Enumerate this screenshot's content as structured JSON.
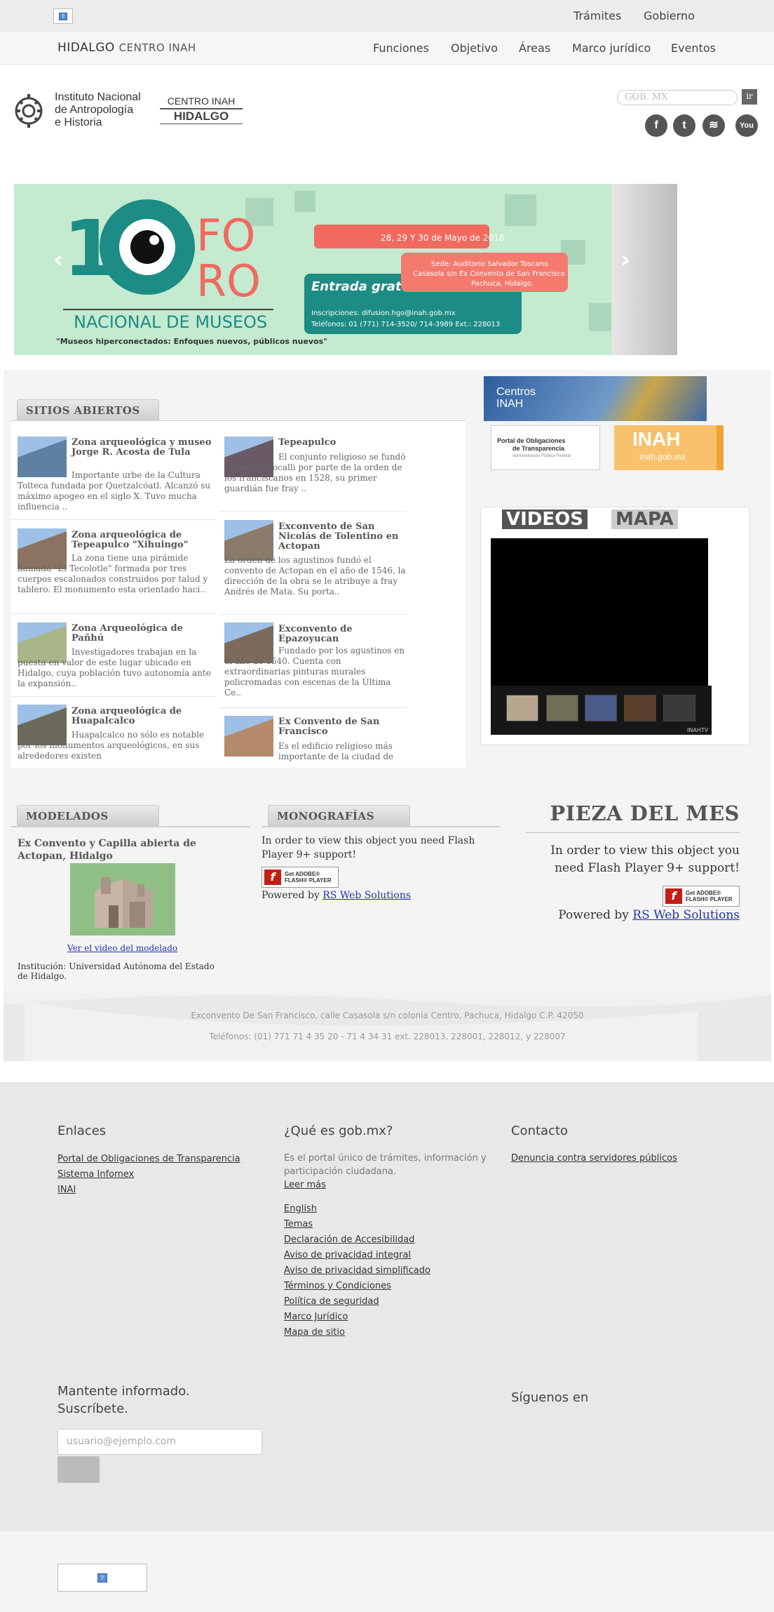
{
  "gob_bar": {
    "links": [
      "Trámites",
      "Gobierno"
    ]
  },
  "nav": {
    "brand": "HIDALGO",
    "brand_sub": "CENTRO INAH",
    "links": [
      "Funciones",
      "Objetivo",
      "Áreas",
      "Marco jurídico",
      "Eventos"
    ]
  },
  "header": {
    "logo_text": [
      "Instituto Nacional",
      "de Antropología",
      "e Historia"
    ],
    "centro_line1": "CENTRO INAH",
    "centro_line2": "HIDALGO",
    "search_placeholder": "GOB. MX",
    "search_button": "ir",
    "social": [
      "facebook-icon",
      "twitter-icon",
      "rss-icon",
      "youtube-icon"
    ]
  },
  "banner": {
    "number": "10",
    "foro1": "FO",
    "foro2": "RO",
    "subtitle": "NACIONAL DE MUSEOS",
    "tagline": "\"Museos hiperconectados: Enfoques nuevos, públicos nuevos\"",
    "dates": "28, 29 Y 30 de Mayo de 2018",
    "sede": [
      "Sede: Auditorio Salvador Toscano",
      "Casasola s/n Ex Convento de San Francisco",
      "Pachuca, Hidalgo."
    ],
    "entrada": "Entrada gratuita",
    "inscripciones": "Inscripciones: difusion.hgo@inah.gob.mx",
    "telefonos": "Teléfonos: 01 (771) 714-3520/ 714-3989   Ext.: 228013",
    "colors": {
      "teal": "#1d8c84",
      "coral": "#f06a5f",
      "mint": "#c4ead0"
    }
  },
  "sitios": {
    "heading": "SITIOS ABIERTOS",
    "left": [
      {
        "title": "Zona arqueológica y museo Jorge R. Acosta de Tula",
        "desc": "Importante urbe de la Cultura Tolteca fundada por Quetzalcóatl. Alcanzó su máximo apogeo en el siglo X. Tuvo mucha influencia ..",
        "color": "#5f7fa3"
      },
      {
        "title": "Zona arqueológica de Tepeapulco \"Xihuingo\"",
        "desc": "La zona tiene una pirámide llamada \"El Tecolotle\" formada por tres cuerpos escalonados construidos por talud y tablero. El monumento esta orientado haci..",
        "color": "#8a7360"
      },
      {
        "title": "Zona Arqueológica de Pañhú",
        "desc": "Investigadores trabajan en la puesta en valor de este lugar ubicado en Hidalgo, cuya población tuvo autonomía ante la expansión..",
        "color": "#a9b68a"
      },
      {
        "title": "Zona arqueológica de Huapalcalco",
        "desc": "Huapalcalco no sólo es notable por los monumentos arqueológicos, en sus alrededores existen",
        "color": "#6b6a5a"
      }
    ],
    "right": [
      {
        "title": "Tepeapulco",
        "desc": "El conjunto religioso se fundó sobre un teocalli por parte de la orden de los franciscanos en 1528, su primer guardián fue fray ..",
        "color": "#6a5a66"
      },
      {
        "title": "Exconvento de San Nicolás de Tolentino en Actopan",
        "desc": "La orden de los agustinos fundó el convento de Actopan en el año de 1546, la dirección de la obra se le atribuye a fray Andrés de Mata. Su porta..",
        "color": "#8a7a6a"
      },
      {
        "title": "Exconvento de Epazoyucan",
        "desc": "Fundado por los agustinos en el año de 1540. Cuenta con extraordinarias pinturas murales policromadas con escenas de la Última Ce..",
        "color": "#7d6a5d"
      },
      {
        "title": "Ex Convento de San Francisco",
        "desc": "Es el edificio religioso más importante de la ciudad de",
        "color": "#b48a6a"
      }
    ]
  },
  "right_col": {
    "centros": [
      "Centros",
      "INAH"
    ],
    "oblig": [
      "Portal de Obligaciones",
      "de Transparencia"
    ],
    "oblig_sub": "Administración Pública Federal",
    "inah_big": "INAH",
    "inah_small": "inah.gob.mx",
    "video_tabs": [
      "VIDEOS",
      "MAPA"
    ],
    "inahtv": "INAHTV"
  },
  "modelados": {
    "heading": "MODELADOS",
    "title": "Ex Convento y Capilla abierta de Actopan, Hidalgo",
    "link": "Ver el video del modelado",
    "institution": "Institución: Universidad Autónoma del Estado de Hidalgo."
  },
  "monografias": {
    "heading": "MONOGRAFÍAS",
    "flash_msg": "In order to view this object you need Flash Player 9+ support!",
    "powered": "Powered by",
    "powered_link": "RS Web Solutions"
  },
  "pieza": {
    "heading": "PIEZA DEL MES",
    "flash_msg": "In order to view this object you need Flash Player 9+ support!",
    "powered": "Powered by",
    "powered_link": "RS Web Solutions"
  },
  "flash_badge": {
    "line1": "Get ADOBE®",
    "line2": "FLASH® PLAYER"
  },
  "address": {
    "line1": "Exconvento De San Francisco, calle Casasola s/n colonia Centro, Pachuca, Hidalgo C.P. 42050",
    "line2": "Teléfonos: (01) 771 71 4 35 20 - 71 4 34 31 ext. 228013, 228001, 228012, y 228007"
  },
  "footer": {
    "enlaces_head": "Enlaces",
    "enlaces": [
      "Portal de Obligaciones de Transparencia",
      "Sistema Infomex",
      "INAI"
    ],
    "que_head": "¿Qué es gob.mx?",
    "que_text": "Es el portal único de trámites, información y participación ciudadana.",
    "leer_mas": "Leer más",
    "que_links": [
      "English",
      "Temas",
      "Declaración de Accesibilidad",
      "Aviso de privacidad integral",
      "Aviso de privacidad simplificado",
      "Términos y Condiciones",
      "Política de seguridad",
      "Marco Jurídico",
      "Mapa de sitio"
    ],
    "contacto_head": "Contacto",
    "contacto_link": "Denuncia contra servidores públicos",
    "subscribe_head": [
      "Mantente informado.",
      "Suscríbete."
    ],
    "subscribe_placeholder": "usuario@ejemplo.com",
    "siguenos": "Síguenos en"
  }
}
